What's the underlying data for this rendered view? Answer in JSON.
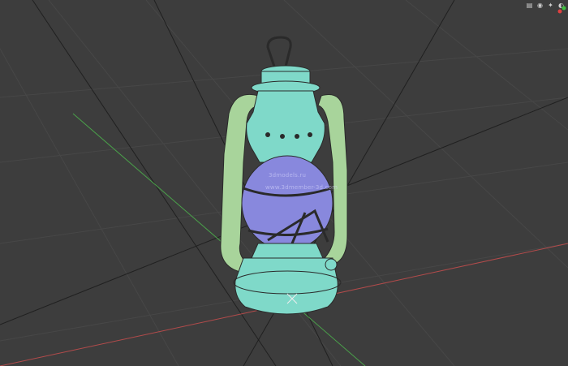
{
  "viewport": {
    "name": "3d-viewport",
    "background": "#3d3d3d",
    "grid_color": "#4a4a4a",
    "axis_x_color": "#b34b4b",
    "axis_y_color": "#4aa04a"
  },
  "model": {
    "name": "oil-lantern",
    "body_color": "#7fd9c9",
    "glass_color": "#8888dd",
    "handle_color": "#a8d49b",
    "wire_color": "#2a2a2a"
  },
  "toolbar": {
    "icons": [
      "view-options-icon",
      "camera-icon",
      "light-icon",
      "render-icon"
    ]
  },
  "watermark": {
    "line1": "3dmodels.ru",
    "line2": "www.3dmember-3d.com"
  }
}
